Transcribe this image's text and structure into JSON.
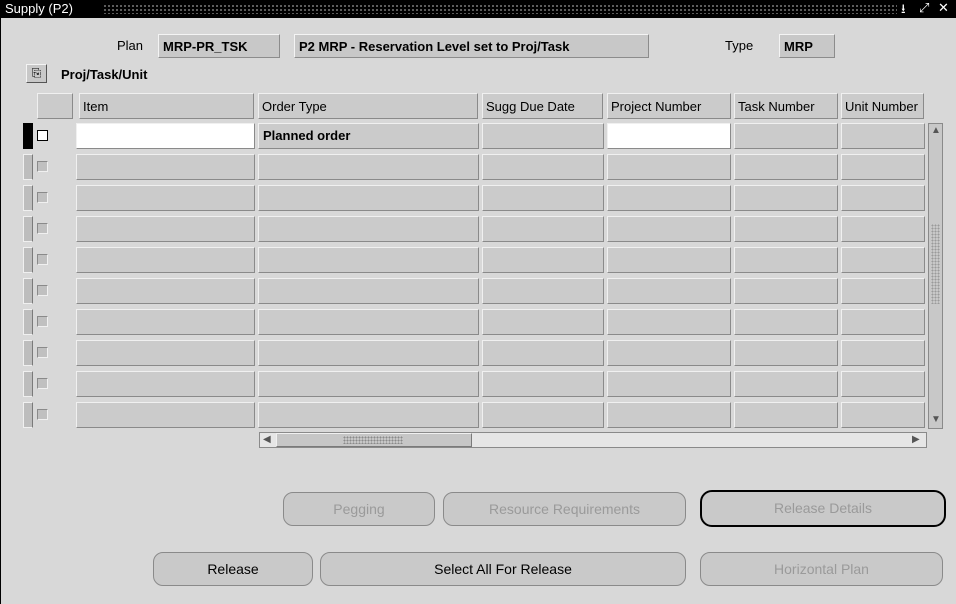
{
  "window": {
    "title": "Supply (P2)",
    "controls": [
      "⭳",
      "⤢",
      "✕"
    ]
  },
  "header": {
    "plan_label": "Plan",
    "plan_value": "MRP-PR_TSK",
    "plan_desc": "P2 MRP - Reservation Level set to Proj/Task",
    "type_label": "Type",
    "type_value": "MRP"
  },
  "region": {
    "title": "Proj/Task/Unit"
  },
  "table": {
    "columns": [
      "Item",
      "Order Type",
      "Sugg Due Date",
      "Project Number",
      "Task Number",
      "Unit Number"
    ],
    "rows": [
      [
        "",
        "Planned order",
        "",
        "",
        "",
        ""
      ],
      [
        "",
        "",
        "",
        "",
        "",
        ""
      ],
      [
        "",
        "",
        "",
        "",
        "",
        ""
      ],
      [
        "",
        "",
        "",
        "",
        "",
        ""
      ],
      [
        "",
        "",
        "",
        "",
        "",
        ""
      ],
      [
        "",
        "",
        "",
        "",
        "",
        ""
      ],
      [
        "",
        "",
        "",
        "",
        "",
        ""
      ],
      [
        "",
        "",
        "",
        "",
        "",
        ""
      ],
      [
        "",
        "",
        "",
        "",
        "",
        ""
      ],
      [
        "",
        "",
        "",
        "",
        "",
        ""
      ]
    ]
  },
  "buttons": {
    "pegging": "Pegging",
    "resource_requirements": "Resource Requirements",
    "release_details": "Release Details",
    "release": "Release",
    "select_all": "Select All For Release",
    "horizontal_plan": "Horizontal Plan"
  },
  "colors": {
    "titlebar": "#000000",
    "window_bg": "#d8d8d8",
    "field_bg": "#c8c8c8",
    "active_cell": "#ffffff"
  }
}
